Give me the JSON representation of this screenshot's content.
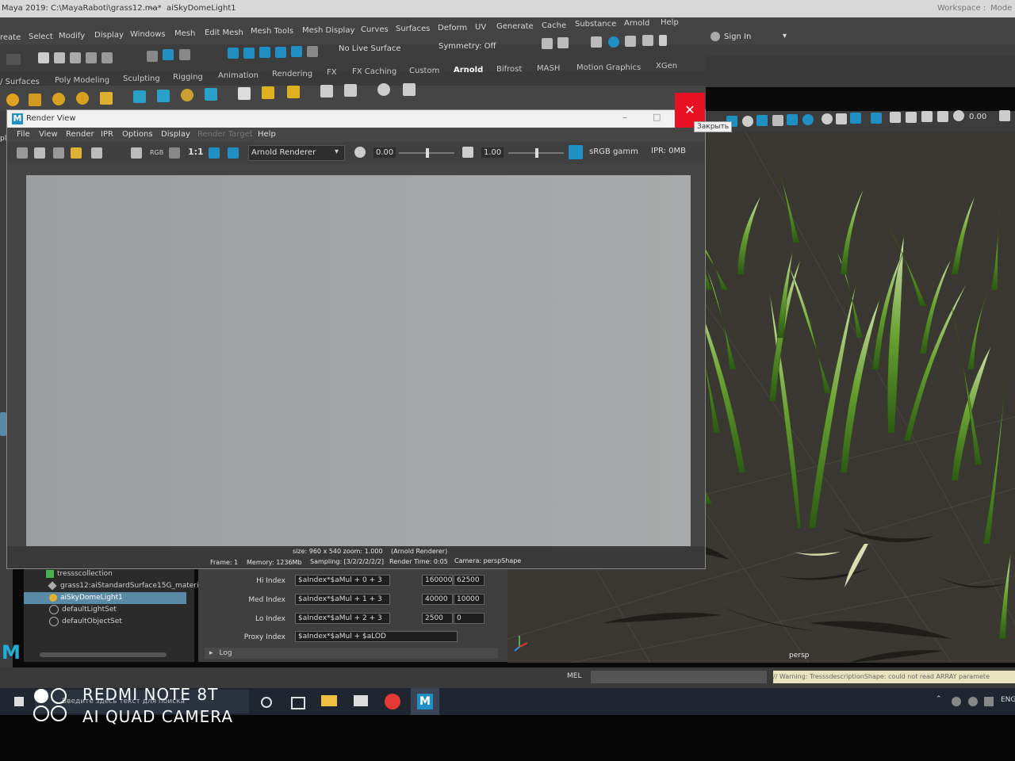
{
  "app": {
    "title": "Maya 2019: C:\\MayaRaboti\\grass12.ma*",
    "title_suffix": "---",
    "selected_object": "aiSkyDomeLight1",
    "workspace_label": "Workspace :",
    "workspace_value": "Mode"
  },
  "main_menu": [
    "reate",
    "Select",
    "Modify",
    "Display",
    "Windows",
    "Mesh",
    "Edit Mesh",
    "Mesh Tools",
    "Mesh Display",
    "Curves",
    "Surfaces",
    "Deform",
    "UV",
    "Generate",
    "Cache",
    "Substance",
    "Arnold",
    "Help"
  ],
  "status_line": {
    "live_surface": "No Live Surface",
    "symmetry": "Symmetry: Off",
    "sign_in": "Sign In"
  },
  "shelf_tabs": [
    "/ Surfaces",
    "Poly Modeling",
    "Sculpting",
    "Rigging",
    "Animation",
    "Rendering",
    "FX",
    "FX Caching",
    "Custom",
    "Arnold",
    "Bifrost",
    "MASH",
    "Motion Graphics",
    "XGen"
  ],
  "active_shelf_tab": "Arnold",
  "viewport_toolbar": {
    "value": "0.00",
    "left_fragment": "pl"
  },
  "render_view": {
    "title": "Render View",
    "close_tooltip": "Закрыть",
    "menu": [
      "File",
      "View",
      "Render",
      "IPR",
      "Options",
      "Display",
      "Render Target",
      "Help"
    ],
    "renderer": "Arnold Renderer",
    "exposure": "0.00",
    "gamma": "1.00",
    "ratio_label": "1:1",
    "rgb_label": "RGB",
    "color_space": "sRGB gamm",
    "ipr_memory": "IPR: 0MB",
    "status": {
      "size": "size: 960 x 540  zoom: 1.000",
      "renderer_tag": "(Arnold Renderer)",
      "frame": "Frame: 1",
      "memory": "Memory: 1236Mb",
      "sampling": "Sampling: [3/2/2/2/2/2]",
      "render_time": "Render Time: 0:05",
      "camera": "Camera: perspShape"
    }
  },
  "outliner": {
    "items": [
      {
        "label": "tressscollection",
        "selected": false
      },
      {
        "label": "grass12:aiStandardSurface15G_materi",
        "selected": false
      },
      {
        "label": "aiSkyDomeLight1",
        "selected": true
      },
      {
        "label": "defaultLightSet",
        "selected": false
      },
      {
        "label": "defaultObjectSet",
        "selected": false
      }
    ]
  },
  "attributes": {
    "rows": [
      {
        "label": "Hi Index",
        "expr": "$aIndex*$aMul + 0 + 3",
        "v1": "160000",
        "v2": "62500"
      },
      {
        "label": "Med Index",
        "expr": "$aIndex*$aMul + 1 + 3",
        "v1": "40000",
        "v2": "10000"
      },
      {
        "label": "Lo Index",
        "expr": "$aIndex*$aMul + 2 + 3",
        "v1": "2500",
        "v2": "0"
      },
      {
        "label": "Proxy Index",
        "expr": "$aIndex*$aMul + $aLOD",
        "v1": "",
        "v2": ""
      }
    ],
    "log_label": "Log"
  },
  "viewport": {
    "camera_label": "persp"
  },
  "command_line": {
    "mel_label": "MEL",
    "warning": "// Warning: TresssdescriptionShape: could not read ARRAY paramete"
  },
  "taskbar": {
    "search_placeholder": "Введите здесь текст для поиска",
    "lang": "ENG"
  },
  "watermark": {
    "line1": "REDMI NOTE 8T",
    "line2": "AI QUAD CAMERA"
  },
  "colors": {
    "maya_blue": "#1f8fc4",
    "close_red": "#e81123",
    "grass_green": "#5e9a2e",
    "selection": "#5a8aa6"
  }
}
